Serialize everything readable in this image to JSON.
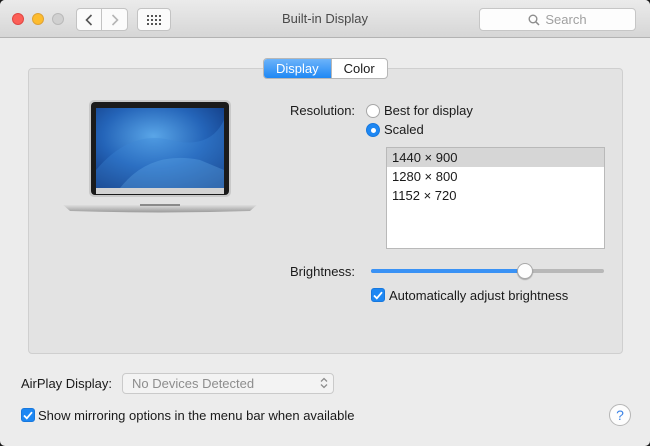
{
  "window": {
    "title": "Built-in Display"
  },
  "toolbar": {
    "search_placeholder": "Search"
  },
  "tabs": [
    {
      "label": "Display",
      "active": true
    },
    {
      "label": "Color",
      "active": false
    }
  ],
  "resolution": {
    "label": "Resolution:",
    "options": [
      {
        "label": "Best for display",
        "selected": false
      },
      {
        "label": "Scaled",
        "selected": true
      }
    ],
    "list": [
      "1440 × 900",
      "1280 × 800",
      "1152 × 720"
    ],
    "selected_index": 0
  },
  "brightness": {
    "label": "Brightness:",
    "level": 0.66
  },
  "auto_brightness": {
    "label": "Automatically adjust brightness",
    "checked": true
  },
  "airplay": {
    "label": "AirPlay Display:",
    "value": "No Devices Detected"
  },
  "mirroring": {
    "label": "Show mirroring options in the menu bar when available",
    "checked": true
  },
  "help": {
    "label": "?"
  },
  "colors": {
    "accent": "#1d87f3",
    "close": "#fc5f57",
    "minimize": "#fdbc2e"
  },
  "icons": [
    "chevron-left-icon",
    "chevron-right-icon",
    "grid-icon",
    "search-icon",
    "laptop-image",
    "checkmark-icon",
    "updown-arrows-icon"
  ]
}
